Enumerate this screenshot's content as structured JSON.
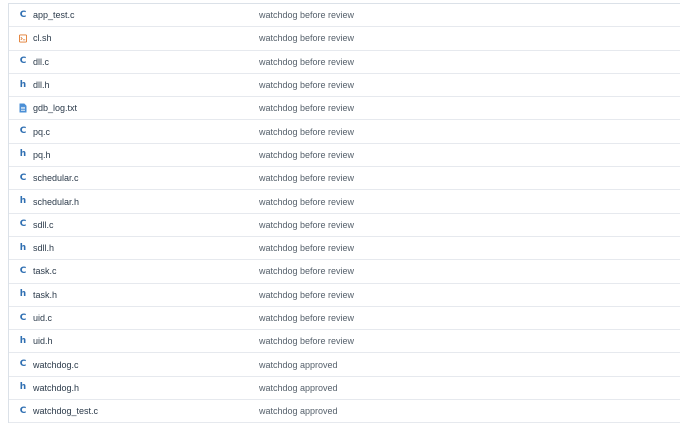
{
  "files": [
    {
      "name": "app_test.c",
      "icon": "c-file-icon",
      "message": "watchdog before review"
    },
    {
      "name": "cl.sh",
      "icon": "shell-file-icon",
      "message": "watchdog before review"
    },
    {
      "name": "dll.c",
      "icon": "c-file-icon",
      "message": "watchdog before review"
    },
    {
      "name": "dll.h",
      "icon": "h-file-icon",
      "message": "watchdog before review"
    },
    {
      "name": "gdb_log.txt",
      "icon": "text-file-icon",
      "message": "watchdog before review"
    },
    {
      "name": "pq.c",
      "icon": "c-file-icon",
      "message": "watchdog before review"
    },
    {
      "name": "pq.h",
      "icon": "h-file-icon",
      "message": "watchdog before review"
    },
    {
      "name": "schedular.c",
      "icon": "c-file-icon",
      "message": "watchdog before review"
    },
    {
      "name": "schedular.h",
      "icon": "h-file-icon",
      "message": "watchdog before review"
    },
    {
      "name": "sdll.c",
      "icon": "c-file-icon",
      "message": "watchdog before review"
    },
    {
      "name": "sdll.h",
      "icon": "h-file-icon",
      "message": "watchdog before review"
    },
    {
      "name": "task.c",
      "icon": "c-file-icon",
      "message": "watchdog before review"
    },
    {
      "name": "task.h",
      "icon": "h-file-icon",
      "message": "watchdog before review"
    },
    {
      "name": "uid.c",
      "icon": "c-file-icon",
      "message": "watchdog before review"
    },
    {
      "name": "uid.h",
      "icon": "h-file-icon",
      "message": "watchdog before review"
    },
    {
      "name": "watchdog.c",
      "icon": "c-file-icon",
      "message": "watchdog approved"
    },
    {
      "name": "watchdog.h",
      "icon": "h-file-icon",
      "message": "watchdog approved"
    },
    {
      "name": "watchdog_test.c",
      "icon": "c-file-icon",
      "message": "watchdog approved"
    }
  ],
  "colors": {
    "c_icon": "#2f6fb2",
    "h_icon": "#2f6fb2",
    "shell_icon": "#e07a2e",
    "text_icon": "#4a8fd6"
  }
}
